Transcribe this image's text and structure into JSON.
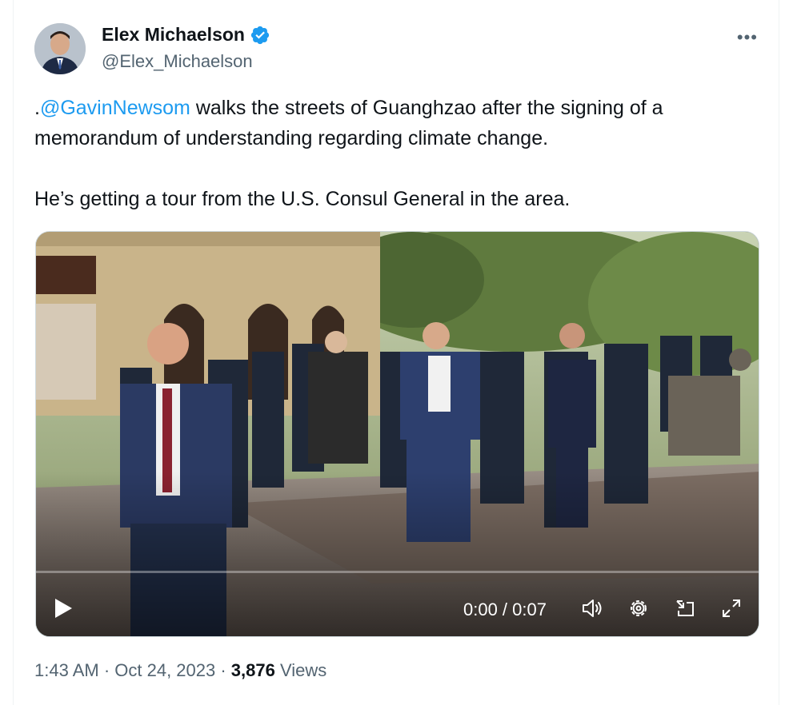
{
  "author": {
    "display_name": "Elex Michaelson",
    "handle": "@Elex_Michaelson",
    "verified_icon": "verified-badge-icon"
  },
  "tweet": {
    "prefix": ".",
    "mention": "@GavinNewsom",
    "line1_rest": " walks the streets of Guanghzao after the signing of a memorandum of understanding regarding climate change.",
    "paragraph2": "He’s getting a tour from the U.S. Consul General in the area."
  },
  "video": {
    "progress": 0,
    "time": "0:00 / 0:07",
    "icons": [
      "play-icon",
      "volume-icon",
      "settings-icon",
      "pip-icon",
      "fullscreen-icon"
    ]
  },
  "meta": {
    "timestamp": "1:43 AM · Oct 24, 2023 · ",
    "views_count": "3,876",
    "views_label": " Views"
  },
  "colors": {
    "accent": "#1d9bf0",
    "text": "#0f1419",
    "secondary": "#536471"
  }
}
